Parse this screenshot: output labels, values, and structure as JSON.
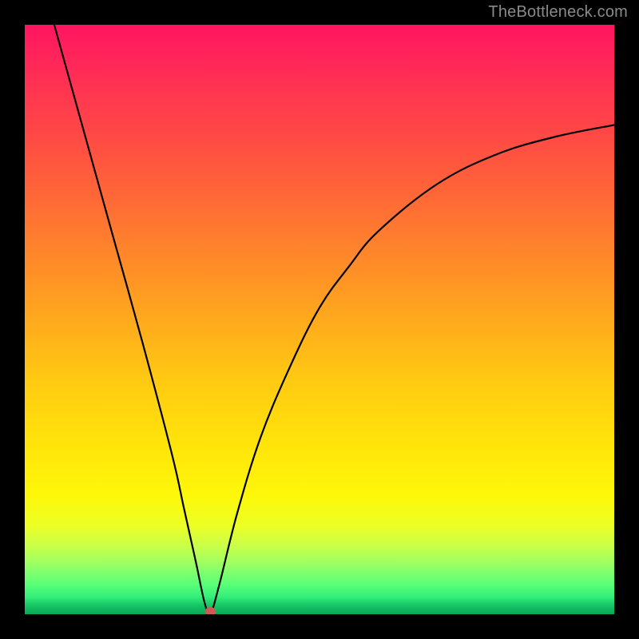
{
  "watermark": "TheBottleneck.com",
  "colors": {
    "background": "#000000",
    "curve_stroke": "#000000",
    "marker_fill": "#cc5a55",
    "gradient_top": "#ff1561",
    "gradient_bottom": "#0aa853"
  },
  "chart_data": {
    "type": "line",
    "title": "",
    "xlabel": "",
    "ylabel": "",
    "xlim": [
      0,
      100
    ],
    "ylim": [
      0,
      100
    ],
    "grid": false,
    "legend": false,
    "series": [
      {
        "name": "curve",
        "x": [
          5,
          10,
          15,
          20,
          25,
          27,
          29,
          30.5,
          31.5,
          33,
          36,
          40,
          45,
          50,
          55,
          60,
          70,
          80,
          90,
          100
        ],
        "y": [
          100,
          82,
          64,
          46,
          27,
          18,
          9,
          2,
          0.2,
          5,
          17,
          30,
          42,
          52,
          59,
          65,
          73,
          78,
          81,
          83
        ]
      }
    ],
    "marker": {
      "x": 31.5,
      "y": 0.2,
      "color": "#cc5a55"
    }
  }
}
